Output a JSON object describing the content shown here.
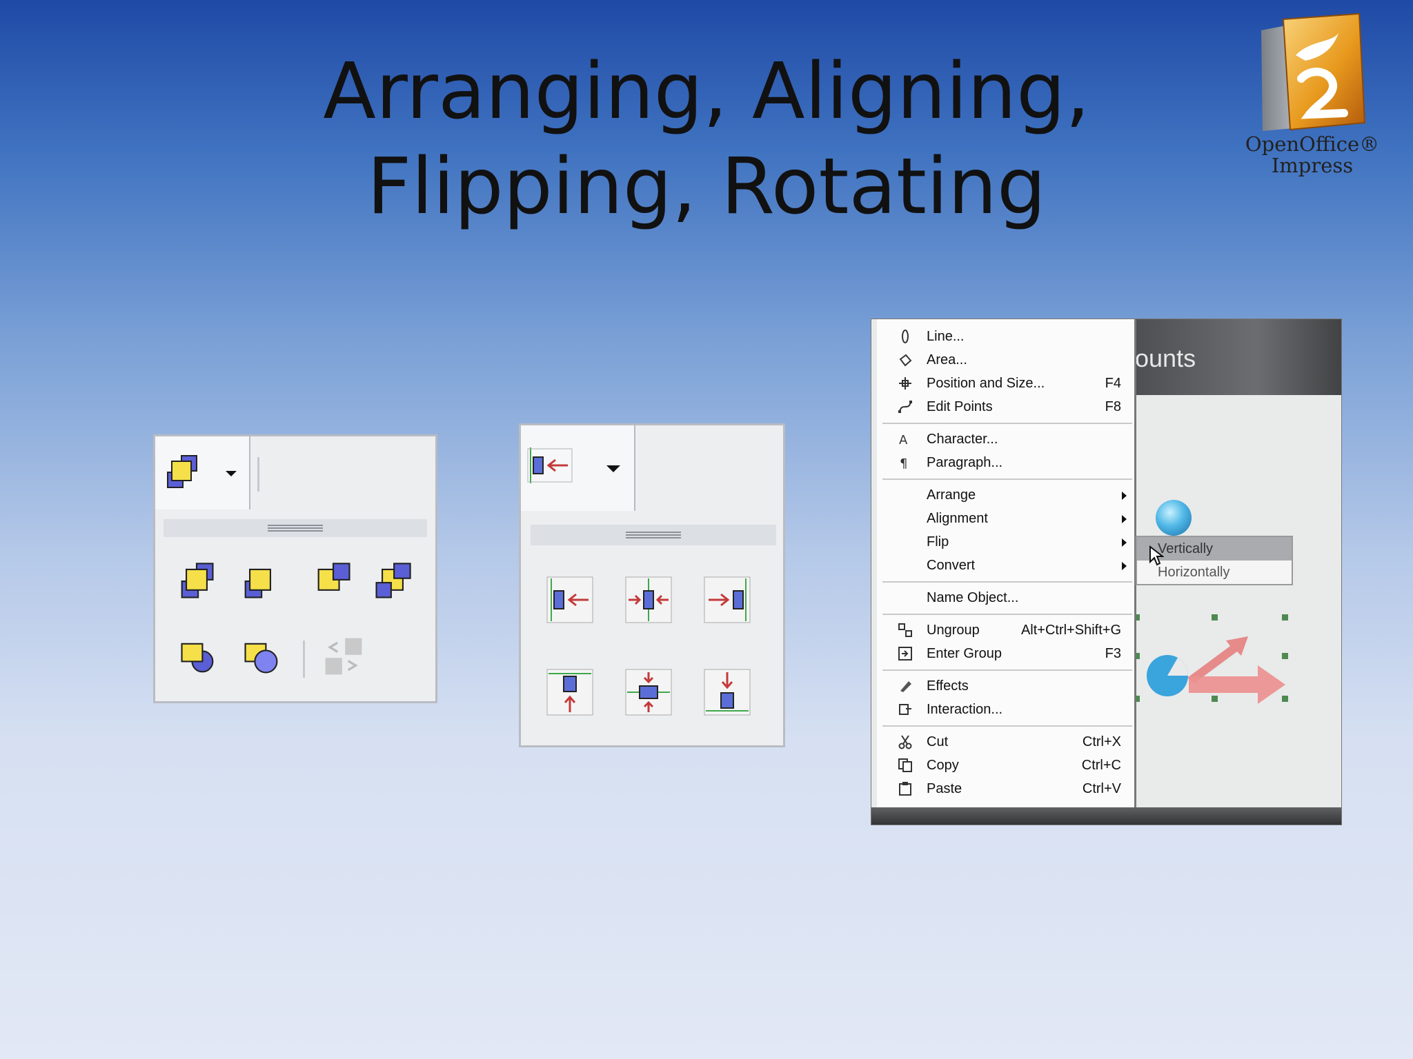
{
  "slide": {
    "title_line1": "Arranging, Aligning,",
    "title_line2": "Flipping, Rotating"
  },
  "logo": {
    "line1": "OpenOffice®",
    "line2": "Impress",
    "icon": "openoffice-gull-logo"
  },
  "arrange_toolbar": {
    "icons": [
      "bring-to-front-icon",
      "bring-forward-icon",
      "send-backward-icon",
      "send-to-back-icon",
      "in-front-of-object-icon",
      "behind-object-icon",
      "reverse-order-icon"
    ],
    "colors": {
      "front": "#f5e04a",
      "back": "#5b5fd6"
    }
  },
  "align_toolbar": {
    "icons": [
      "align-left-icon",
      "align-center-horizontal-icon",
      "align-right-icon",
      "align-top-icon",
      "align-center-vertical-icon",
      "align-bottom-icon"
    ],
    "colors": {
      "box": "#5b6ed8",
      "arrow": "#c43a3a",
      "guide": "#3fa84a"
    }
  },
  "context_menu": {
    "background_label": "ounts",
    "groups": [
      [
        {
          "label": "Line...",
          "shortcut": "",
          "icon": "line-icon"
        },
        {
          "label": "Area...",
          "shortcut": "",
          "icon": "area-fill-icon"
        },
        {
          "label": "Position and Size...",
          "shortcut": "F4",
          "icon": "position-size-icon"
        },
        {
          "label": "Edit Points",
          "shortcut": "F8",
          "icon": "edit-points-icon"
        }
      ],
      [
        {
          "label": "Character...",
          "shortcut": "",
          "icon": "character-icon"
        },
        {
          "label": "Paragraph...",
          "shortcut": "",
          "icon": "paragraph-icon"
        }
      ],
      [
        {
          "label": "Arrange",
          "shortcut": "",
          "submenu": true
        },
        {
          "label": "Alignment",
          "shortcut": "",
          "submenu": true
        },
        {
          "label": "Flip",
          "shortcut": "",
          "submenu": true
        },
        {
          "label": "Convert",
          "shortcut": "",
          "submenu": true
        }
      ],
      [
        {
          "label": "Name Object...",
          "shortcut": ""
        }
      ],
      [
        {
          "label": "Ungroup",
          "shortcut": "Alt+Ctrl+Shift+G",
          "icon": "ungroup-icon"
        },
        {
          "label": "Enter Group",
          "shortcut": "F3",
          "icon": "enter-group-icon"
        }
      ],
      [
        {
          "label": "Effects",
          "shortcut": "",
          "icon": "effects-icon"
        },
        {
          "label": "Interaction...",
          "shortcut": "",
          "icon": "interaction-icon"
        }
      ],
      [
        {
          "label": "Cut",
          "shortcut": "Ctrl+X",
          "icon": "scissors-icon"
        },
        {
          "label": "Copy",
          "shortcut": "Ctrl+C",
          "icon": "copy-icon"
        },
        {
          "label": "Paste",
          "shortcut": "Ctrl+V",
          "icon": "paste-icon"
        }
      ]
    ],
    "flip_submenu": [
      {
        "label": "Vertically",
        "highlighted": true
      },
      {
        "label": "Horizontally",
        "highlighted": false
      }
    ]
  }
}
